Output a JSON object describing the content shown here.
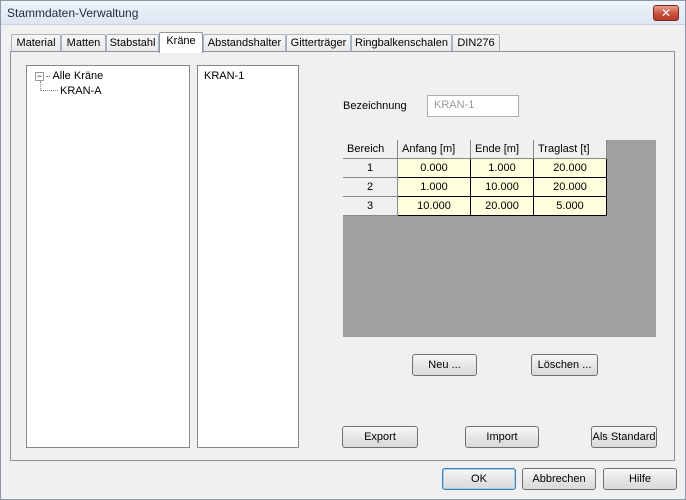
{
  "window": {
    "title": "Stammdaten-Verwaltung",
    "close_label": "✕"
  },
  "tabs": [
    "Material",
    "Matten",
    "Stabstahl",
    "Kräne",
    "Abstandshalter",
    "Gitterträger",
    "Ringbalkenschalen",
    "DIN276"
  ],
  "active_tab": "Kräne",
  "tree": {
    "expander": "−",
    "root": "Alle Kräne",
    "child": "KRAN-A"
  },
  "list": {
    "items": [
      "KRAN-1"
    ]
  },
  "form": {
    "bezeichnung_label": "Bezeichnung",
    "bezeichnung_value": "KRAN-1"
  },
  "grid": {
    "headers": [
      "Bereich",
      "Anfang [m]",
      "Ende [m]",
      "Traglast [t]"
    ],
    "rows": [
      {
        "bereich": "1",
        "anfang": "0.000",
        "ende": "1.000",
        "traglast": "20.000"
      },
      {
        "bereich": "2",
        "anfang": "1.000",
        "ende": "10.000",
        "traglast": "20.000"
      },
      {
        "bereich": "3",
        "anfang": "10.000",
        "ende": "20.000",
        "traglast": "5.000"
      }
    ]
  },
  "buttons": {
    "neu": "Neu ...",
    "loeschen": "Löschen ...",
    "export": "Export",
    "import": "Import",
    "als_standard": "Als Standard",
    "ok": "OK",
    "abbrechen": "Abbrechen",
    "hilfe": "Hilfe"
  }
}
